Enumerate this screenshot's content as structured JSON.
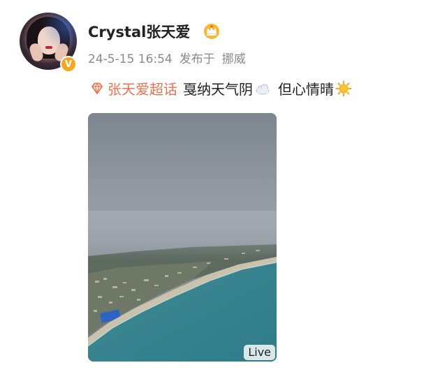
{
  "post": {
    "username": "Crystal张天爱",
    "date": "24-5-15 16:54",
    "source_prefix": "发布于",
    "location": "挪威",
    "topic": "张天爱超话",
    "text_part1": "戛纳天气阴",
    "text_part2": "但心情晴",
    "live_label": "Live"
  },
  "icons": {
    "crown": "crown-icon",
    "verified": "verified-v-badge",
    "topic": "diamond-supertopic-icon",
    "cloud": "cloud-emoji",
    "sun": "sun-emoji"
  },
  "colors": {
    "topic": "#eb7350",
    "verified_badge": "#f5a623",
    "meta_text": "#8a8a8a"
  },
  "badge_text": "V"
}
